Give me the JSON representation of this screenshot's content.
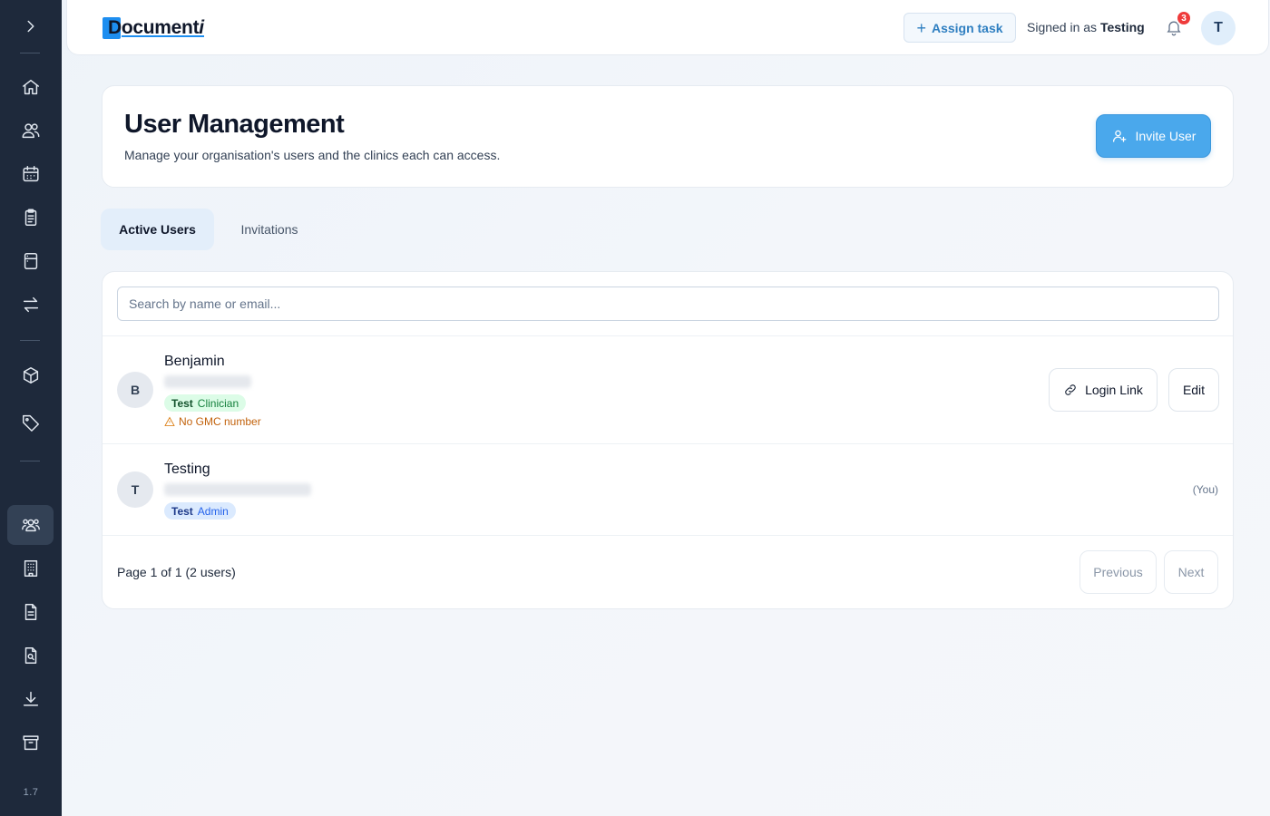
{
  "app": {
    "logo_text_main": "Document",
    "logo_text_italic": "i",
    "version": "1.7"
  },
  "topbar": {
    "assign_task_label": "Assign task",
    "signed_in_prefix": "Signed in as",
    "signed_in_user": "Testing",
    "notification_count": "3",
    "avatar_initial": "T"
  },
  "sidebar": {
    "expand_icon": "chevron-right-icon",
    "items": [
      {
        "name": "home",
        "icon": "home-icon"
      },
      {
        "name": "patients",
        "icon": "users-icon"
      },
      {
        "name": "calendar",
        "icon": "calendar-icon"
      },
      {
        "name": "clipboard",
        "icon": "clipboard-icon"
      },
      {
        "name": "forms",
        "icon": "layout-icon"
      },
      {
        "name": "transfers",
        "icon": "arrows-swap-icon"
      },
      {
        "name": "products",
        "icon": "box-icon"
      },
      {
        "name": "tags",
        "icon": "tag-icon"
      },
      {
        "name": "user-management",
        "icon": "users-group-icon",
        "active": true
      },
      {
        "name": "clinics",
        "icon": "building-icon"
      },
      {
        "name": "documents",
        "icon": "file-text-icon"
      },
      {
        "name": "document-search",
        "icon": "file-search-icon"
      },
      {
        "name": "downloads",
        "icon": "download-icon"
      },
      {
        "name": "archive",
        "icon": "archive-icon"
      }
    ]
  },
  "header": {
    "title": "User Management",
    "subtitle": "Manage your organisation's users and the clinics each can access.",
    "invite_label": "Invite User"
  },
  "tabs": [
    {
      "label": "Active Users",
      "active": true
    },
    {
      "label": "Invitations",
      "active": false
    }
  ],
  "search": {
    "placeholder": "Search by name or email...",
    "value": ""
  },
  "users": [
    {
      "initial": "B",
      "name": "Benjamin",
      "email_redacted": true,
      "role_org": "Test",
      "role": "Clinician",
      "warning": "No GMC number",
      "actions": [
        "Login Link",
        "Edit"
      ]
    },
    {
      "initial": "T",
      "name": "Testing",
      "email_redacted": true,
      "role_org": "Test",
      "role": "Admin",
      "self_label": "(You)"
    }
  ],
  "pagination": {
    "summary": "Page 1 of 1 (2 users)",
    "previous_label": "Previous",
    "next_label": "Next"
  },
  "colors": {
    "sidebar_bg": "#1e293b",
    "accent": "#4aa8ec",
    "brand_blue": "#1d8ef0",
    "badge_red": "#ef3b3b"
  }
}
